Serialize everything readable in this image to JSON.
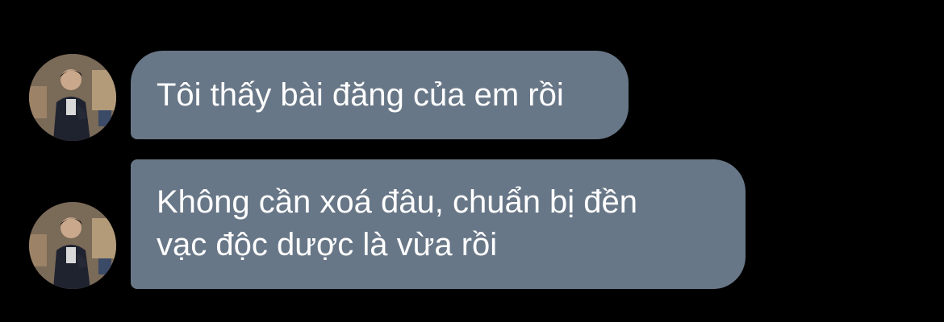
{
  "chat": {
    "messages": [
      {
        "sender_avatar": "profile-photo",
        "text": "Tôi thấy bài đăng của em rồi"
      },
      {
        "sender_avatar": "profile-photo",
        "text": "Không cần xoá đâu, chuẩn bị đền\nvạc độc dược là vừa rồi"
      }
    ]
  },
  "colors": {
    "background": "#000000",
    "bubble": "#687787",
    "text": "#ffffff"
  }
}
